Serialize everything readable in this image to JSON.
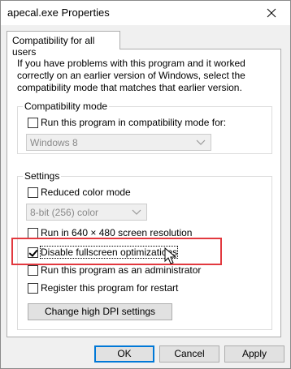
{
  "window": {
    "title": "apecal.exe Properties"
  },
  "tab": {
    "label": "Compatibility for all users"
  },
  "intro_text": "If you have problems with this program and it worked correctly on an earlier version of Windows, select the compatibility mode that matches that earlier version.",
  "compat_mode": {
    "group_label": "Compatibility mode",
    "checkbox_label": "Run this program in compatibility mode for:",
    "checked": false,
    "select_value": "Windows 8"
  },
  "settings": {
    "group_label": "Settings",
    "reduced_color": {
      "label": "Reduced color mode",
      "checked": false
    },
    "color_select_value": "8-bit (256) color",
    "run_640": {
      "label": "Run in 640 × 480 screen resolution",
      "checked": false
    },
    "disable_fullscreen": {
      "label": "Disable fullscreen optimizations",
      "checked": true
    },
    "run_admin": {
      "label": "Run this program as an administrator",
      "checked": false
    },
    "register_restart": {
      "label": "Register this program for restart",
      "checked": false
    },
    "dpi_button": "Change high DPI settings"
  },
  "footer": {
    "ok": "OK",
    "cancel": "Cancel",
    "apply": "Apply"
  },
  "colors": {
    "highlight": "#e2393f",
    "accent": "#0078d7"
  },
  "icons": {
    "close": "close-icon",
    "chevron": "chevron-down-icon",
    "cursor": "mouse-pointer-icon"
  }
}
